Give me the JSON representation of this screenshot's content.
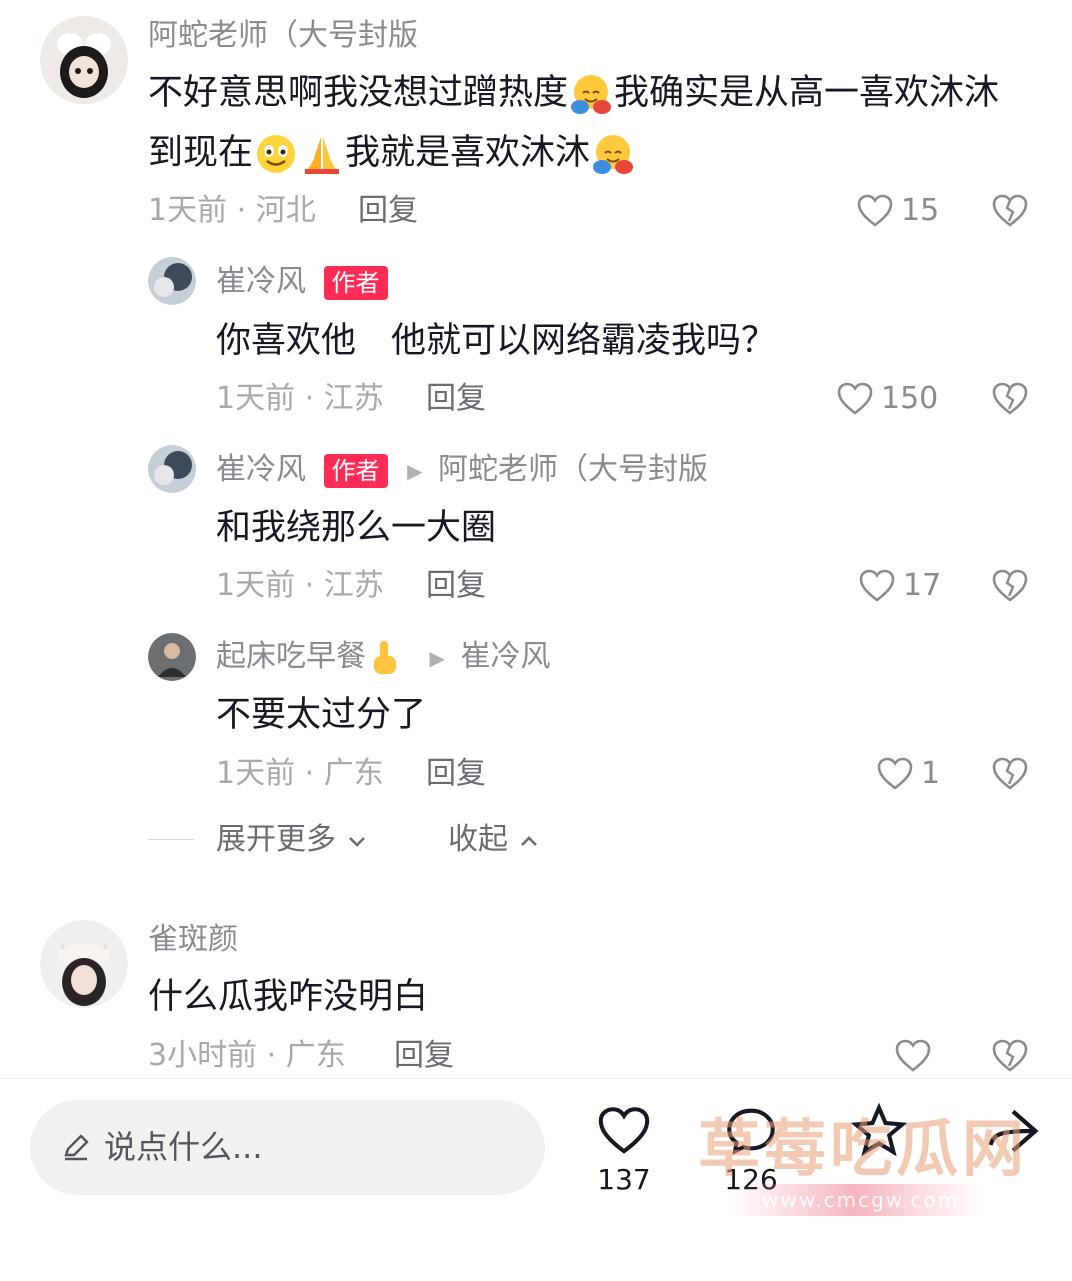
{
  "comments": [
    {
      "user": "阿蛇老师（大号封版",
      "text_line1": "不好意思啊我没想过蹭热度",
      "text_line1b": "我确实是从高一喜欢沐沐",
      "text_line2a": "到现在",
      "text_line2b": "我就是喜欢沐沐",
      "time_location": "1天前 · 河北",
      "reply": "回复",
      "likes": "15"
    },
    {
      "user": "崔冷风",
      "badge": "作者",
      "text": "你喜欢他　他就可以网络霸凌我吗？",
      "time_location": "1天前 · 江苏",
      "reply": "回复",
      "likes": "150"
    },
    {
      "user": "崔冷风",
      "badge": "作者",
      "reply_to": "阿蛇老师（大号封版",
      "text": "和我绕那么一大圈",
      "time_location": "1天前 · 江苏",
      "reply": "回复",
      "likes": "17"
    },
    {
      "user": "起床吃早餐",
      "reply_to": "崔冷风",
      "text": "不要太过分了",
      "time_location": "1天前 · 广东",
      "reply": "回复",
      "likes": "1"
    },
    {
      "user": "雀斑颜",
      "text": "什么瓜我咋没明白",
      "time_location": "3小时前 · 广东",
      "reply": "回复",
      "likes": ""
    }
  ],
  "thread_controls": {
    "expand": "展开更多",
    "collapse": "收起"
  },
  "bottom_bar": {
    "input_placeholder": "说点什么...",
    "like_count": "137",
    "comment_count": "126"
  },
  "watermark": {
    "text": "草莓吃瓜网",
    "url": "www.cmcgw.com"
  },
  "colors": {
    "badge": "#fe2c55",
    "text": "#161823",
    "secondary": "#8a8b91"
  }
}
